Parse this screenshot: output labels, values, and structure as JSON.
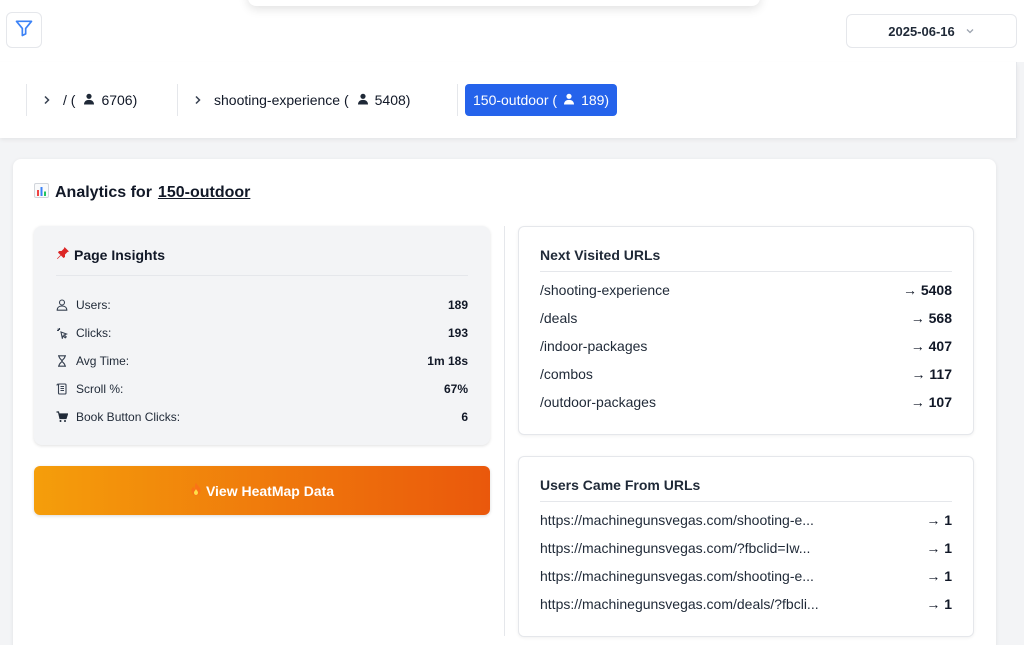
{
  "toolbar": {
    "date_value": "2025-06-16"
  },
  "breadcrumbs": [
    {
      "label": "/ (",
      "count": "6706",
      "suffix": ")"
    },
    {
      "label": "shooting-experience (",
      "count": "5408",
      "suffix": ")"
    }
  ],
  "active_crumb": {
    "label": "150-outdoor (",
    "count": "189",
    "suffix": ")"
  },
  "analytics": {
    "title_prefix": "Analytics for",
    "page_link": "150-outdoor"
  },
  "insights": {
    "title": "Page Insights",
    "rows": [
      {
        "icon": "user-icon",
        "label": "Users:",
        "value": "189"
      },
      {
        "icon": "cursor-click-icon",
        "label": "Clicks:",
        "value": "193"
      },
      {
        "icon": "hourglass-icon",
        "label": "Avg Time:",
        "value": "1m 18s"
      },
      {
        "icon": "scroll-icon",
        "label": "Scroll %:",
        "value": "67%"
      },
      {
        "icon": "cart-icon",
        "label": "Book Button Clicks:",
        "value": "6"
      }
    ]
  },
  "heatmap_button": {
    "label": "View HeatMap Data"
  },
  "next_visited": {
    "title": "Next Visited URLs",
    "rows": [
      {
        "url": "/shooting-experience",
        "value": "→ 5408"
      },
      {
        "url": "/deals",
        "value": "→ 568"
      },
      {
        "url": "/indoor-packages",
        "value": "→ 407"
      },
      {
        "url": "/combos",
        "value": "→ 117"
      },
      {
        "url": "/outdoor-packages",
        "value": "→ 107"
      }
    ]
  },
  "came_from": {
    "title": "Users Came From URLs",
    "rows": [
      {
        "url": "https://machinegunsvegas.com/shooting-e...",
        "value": "→ 1"
      },
      {
        "url": "https://machinegunsvegas.com/?fbclid=Iw...",
        "value": "→ 1"
      },
      {
        "url": "https://machinegunsvegas.com/shooting-e...",
        "value": "→ 1"
      },
      {
        "url": "https://machinegunsvegas.com/deals/?fbcli...",
        "value": "→ 1"
      }
    ]
  }
}
